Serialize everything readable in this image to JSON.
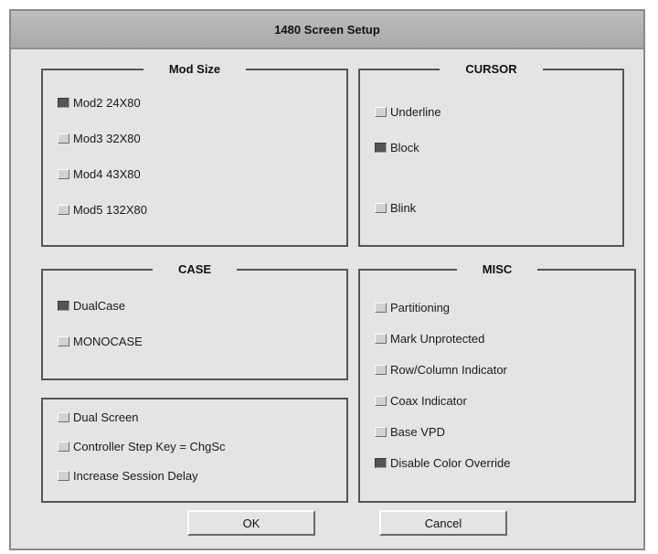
{
  "window": {
    "title": "1480 Screen Setup"
  },
  "mod_size": {
    "title": "Mod Size",
    "options": [
      {
        "label": "Mod2 24X80",
        "checked": true
      },
      {
        "label": "Mod3 32X80",
        "checked": false
      },
      {
        "label": "Mod4 43X80",
        "checked": false
      },
      {
        "label": "Mod5 132X80",
        "checked": false
      }
    ]
  },
  "cursor": {
    "title": "CURSOR",
    "options": [
      {
        "label": "Underline",
        "checked": false
      },
      {
        "label": "Block",
        "checked": true
      },
      {
        "label": "Blink",
        "checked": false
      }
    ]
  },
  "case": {
    "title": "CASE",
    "options": [
      {
        "label": "DualCase",
        "checked": true
      },
      {
        "label": "MONOCASE",
        "checked": false
      }
    ]
  },
  "misc": {
    "title": "MISC",
    "options": [
      {
        "label": "Partitioning",
        "checked": false
      },
      {
        "label": "Mark Unprotected",
        "checked": false
      },
      {
        "label": "Row/Column Indicator",
        "checked": false
      },
      {
        "label": "Coax Indicator",
        "checked": false
      },
      {
        "label": "Base VPD",
        "checked": false
      },
      {
        "label": "Disable Color Override",
        "checked": true
      }
    ]
  },
  "other": {
    "options": [
      {
        "label": "Dual Screen",
        "checked": false
      },
      {
        "label": "Controller Step Key = ChgSc",
        "checked": false
      },
      {
        "label": "Increase Session Delay",
        "checked": false
      }
    ]
  },
  "buttons": {
    "ok": "OK",
    "cancel": "Cancel"
  },
  "colors": {
    "titlebar": "#b4b4b4",
    "dialog_bg": "#e4e4e4",
    "checked_indicator": "#555555"
  }
}
